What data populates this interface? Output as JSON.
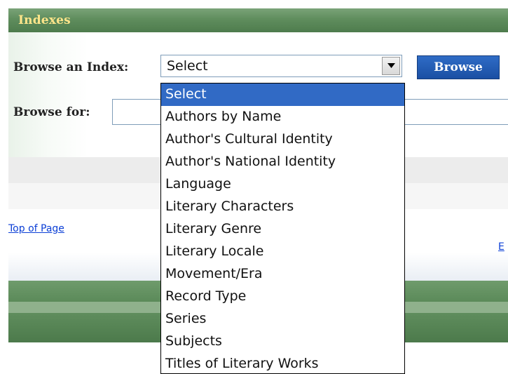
{
  "header": {
    "title": "Indexes"
  },
  "browse_index": {
    "label": "Browse an Index:",
    "selected_value": "Select",
    "button_label": "Browse"
  },
  "browse_for": {
    "label": "Browse for:",
    "value": ""
  },
  "links": {
    "top_of_page": "Top of Page",
    "partial_right": "E"
  },
  "dropdown": {
    "options": [
      "Select",
      "Authors by Name",
      "Author's Cultural Identity",
      "Author's National Identity",
      "Language",
      "Literary Characters",
      "Literary Genre",
      "Literary Locale",
      "Movement/Era",
      "Record Type",
      "Series",
      "Subjects",
      "Titles of Literary Works"
    ],
    "highlighted": "Select"
  },
  "colors": {
    "header_green": "#5f8d5d",
    "title_gold": "#ffe58a",
    "button_blue": "#2f6cc6",
    "selection_blue": "#316ac5",
    "link_blue": "#0b3fd6"
  }
}
